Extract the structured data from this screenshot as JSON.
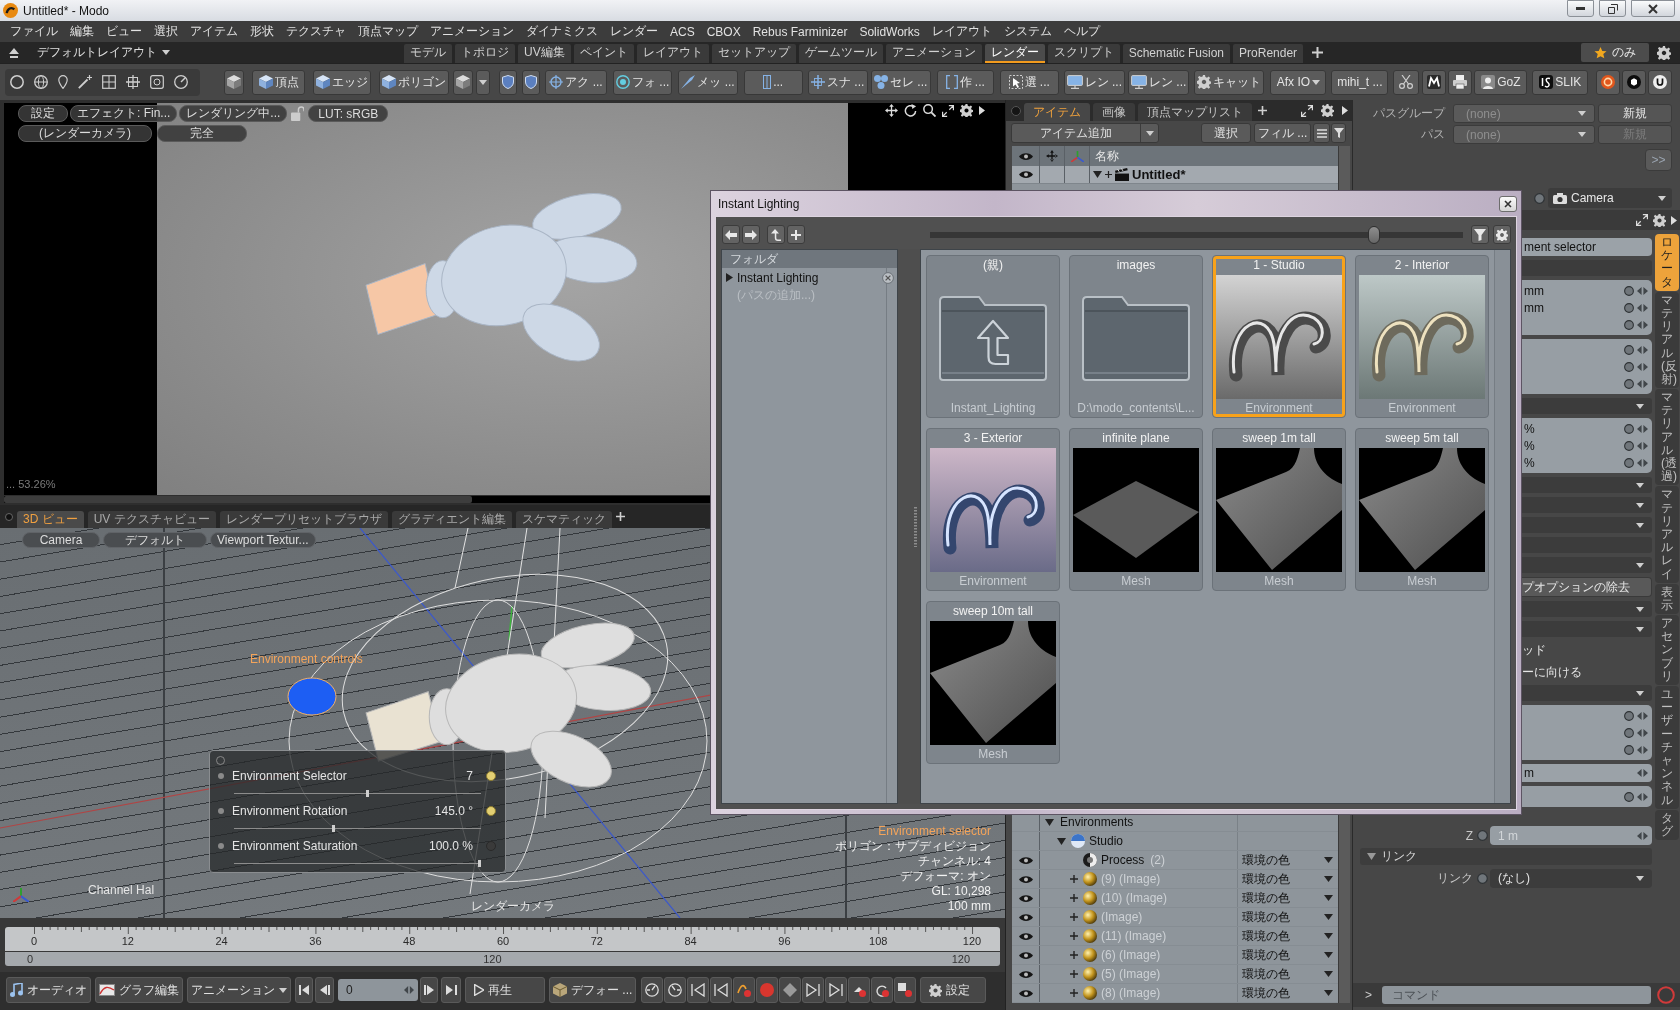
{
  "window": {
    "title": "Untitled* - Modo"
  },
  "menu_bar": [
    "ファイル",
    "編集",
    "ビュー",
    "選択",
    "アイテム",
    "形状",
    "テクスチャ",
    "頂点マップ",
    "アニメーション",
    "ダイナミクス",
    "レンダー",
    "ACS",
    "CBOX",
    "Rebus Farminizer",
    "SolidWorks",
    "レイアウト",
    "システム",
    "ヘルプ"
  ],
  "layout_bar": {
    "layout_menu": "デフォルトレイアウト",
    "tabs": [
      {
        "label": "モデル",
        "selected": false
      },
      {
        "label": "トポロジ",
        "selected": false
      },
      {
        "label": "UV編集",
        "selected": false
      },
      {
        "label": "ペイント",
        "selected": false
      },
      {
        "label": "レイアウト",
        "selected": false
      },
      {
        "label": "セットアップ",
        "selected": false
      },
      {
        "label": "ゲームツール",
        "selected": false
      },
      {
        "label": "アニメーション",
        "selected": false
      },
      {
        "label": "レンダー",
        "selected": true
      },
      {
        "label": "スクリプト",
        "selected": false
      },
      {
        "label": "Schematic Fusion",
        "selected": false
      },
      {
        "label": "ProRender",
        "selected": false
      }
    ],
    "favorites_filter": "のみ"
  },
  "toolbar": [
    "頂点",
    "エッジ",
    "ポリゴン",
    "アク ...",
    "フォ ...",
    "メッ ...",
    "...",
    "スナ ...",
    "セレ ...",
    "作 ...",
    "選 ...",
    "レン ...",
    "レン ...",
    "キャット",
    "Afx IO",
    "mihi_t ...",
    "GoZ",
    "SLIK"
  ],
  "render_view": {
    "buttons": [
      "設定",
      "エフェクト: Fin...",
      "レンダリング中...",
      "LUT: sRGB"
    ],
    "camera": "(レンダーカメラ)",
    "quality": "完全",
    "zoom": "... 53.26%"
  },
  "viewport": {
    "tabs": [
      {
        "label": "3D ビュー",
        "selected": true
      },
      {
        "label": "UV テクスチャビュー",
        "selected": false
      },
      {
        "label": "レンダープリセットブラウザ",
        "selected": false
      },
      {
        "label": "グラディエント編集",
        "selected": false
      },
      {
        "label": "スケマティック",
        "selected": false
      }
    ],
    "buttons": [
      "Camera",
      "デフォルト",
      "Viewport Textur..."
    ],
    "handle_label": "Environment controls",
    "channel_haul": [
      {
        "label": "Environment Selector",
        "value": "7",
        "level": 0.54,
        "keyed": true
      },
      {
        "label": "Environment Rotation",
        "value": "145.0 °",
        "level": 0.4,
        "keyed": true
      },
      {
        "label": "Environment Saturation",
        "value": "100.0 %",
        "level": 1,
        "keyed": false
      }
    ],
    "corner_label": "Channel Hal",
    "camera_label": "レンダーカメラ",
    "info": {
      "title": "Environment selector",
      "lines": [
        "ポリゴン：サブディビジョン",
        "チャンネル: 4",
        "デフォーマ: オン",
        "GL: 10,298",
        "100 mm"
      ]
    }
  },
  "timeline": {
    "ticks": [
      "0",
      "12",
      "24",
      "36",
      "48",
      "60",
      "72",
      "84",
      "96",
      "108",
      "120"
    ],
    "range": [
      "0",
      "120",
      "120"
    ]
  },
  "transport": {
    "audio": "オーディオ",
    "graph_editor": "グラフ編集",
    "animation_menu": "アニメーション",
    "frame": "0",
    "play": "再生",
    "deformers": "デフォー ...",
    "settings": "設定"
  },
  "item_list": {
    "tabs": [
      {
        "label": "アイテム",
        "selected": true
      },
      {
        "label": "画像",
        "selected": false
      },
      {
        "label": "頂点マップリスト",
        "selected": false
      }
    ],
    "add_item": "アイテム追加",
    "select": "選択",
    "filter": "フィル ...",
    "name_header": "名称",
    "items": [
      {
        "name": "Untitled*",
        "expanded": true,
        "visible": true
      }
    ]
  },
  "shader_tree": [
    {
      "kind": "group",
      "name": "Environments",
      "expanded": true,
      "visible": false,
      "children": [
        {
          "kind": "environment",
          "name": "Studio",
          "expanded": true,
          "visible": false,
          "children": [
            {
              "kind": "process",
              "name": "Process",
              "suffix": "(2)",
              "effect": "環境の色",
              "visible": true
            },
            {
              "kind": "image",
              "name": "(9) (Image)",
              "effect": "環境の色",
              "visible": true,
              "expanded": false
            },
            {
              "kind": "image",
              "name": "(10) (Image)",
              "effect": "環境の色",
              "visible": true,
              "expanded": false
            },
            {
              "kind": "image",
              "name": "(Image)",
              "effect": "環境の色",
              "visible": true,
              "expanded": false
            },
            {
              "kind": "image",
              "name": "(11) (Image)",
              "effect": "環境の色",
              "visible": true,
              "expanded": false
            },
            {
              "kind": "image",
              "name": "(6) (Image)",
              "effect": "環境の色",
              "visible": true,
              "expanded": false
            },
            {
              "kind": "image",
              "name": "(5) (Image)",
              "effect": "環境の色",
              "visible": true,
              "expanded": false
            },
            {
              "kind": "image",
              "name": "(8) (Image)",
              "effect": "環境の色",
              "visible": true,
              "expanded": false
            }
          ]
        }
      ]
    }
  ],
  "properties": {
    "path_rows": [
      {
        "label": "パスグループ",
        "value": "(none)",
        "button": "新規",
        "disabled": false
      },
      {
        "label": "パス",
        "value": "(none)",
        "button": "新規",
        "disabled": true
      }
    ],
    "more_button": ">>",
    "camera_menu": "Camera",
    "rows": [
      {
        "kind": "field",
        "text": "ment selector"
      },
      {
        "kind": "bar"
      },
      {
        "kind": "group",
        "channels": [
          {
            "kind": "value",
            "value": "mm"
          },
          {
            "kind": "value",
            "value": "mm"
          },
          {
            "kind": "empty"
          }
        ]
      },
      {
        "kind": "group",
        "channels": [
          {
            "kind": "empty"
          },
          {
            "kind": "empty"
          },
          {
            "kind": "empty"
          }
        ]
      },
      {
        "kind": "dropdown"
      },
      {
        "kind": "group",
        "channels": [
          {
            "kind": "value",
            "value": "%"
          },
          {
            "kind": "value",
            "value": "%"
          },
          {
            "kind": "value",
            "value": "%"
          }
        ]
      },
      {
        "kind": "dropdown"
      },
      {
        "kind": "dropdown"
      },
      {
        "kind": "dropdown"
      },
      {
        "kind": "bar"
      },
      {
        "kind": "dropdown"
      },
      {
        "kind": "button",
        "text": "プオプションの除去"
      },
      {
        "kind": "dropdown"
      },
      {
        "kind": "dropdown"
      },
      {
        "kind": "label",
        "text": "ッド"
      },
      {
        "kind": "label",
        "text": "ーに向ける"
      },
      {
        "kind": "dropdown"
      },
      {
        "kind": "group",
        "channels": [
          {
            "kind": "empty"
          },
          {
            "kind": "empty"
          },
          {
            "kind": "empty"
          }
        ]
      },
      {
        "kind": "field",
        "text": "m"
      },
      {
        "kind": "group",
        "channels": [
          {
            "kind": "empty"
          }
        ]
      }
    ],
    "transform_rows": [
      {
        "label": "Z",
        "value": "1 m",
        "disabled": true
      }
    ],
    "link_section": {
      "title": "リンク",
      "expanded": true,
      "label": "リンク",
      "value": "(なし)"
    },
    "command": {
      "prompt": ">",
      "placeholder": "コマンド"
    },
    "side_tabs": [
      {
        "label": "ロケータ",
        "selected": true
      },
      {
        "label": "マテリアル(反射)",
        "selected": false
      },
      {
        "label": "マテリアル(透過)",
        "selected": false
      },
      {
        "label": "マテリアルレイ",
        "selected": false
      },
      {
        "label": "表示",
        "selected": false
      },
      {
        "label": "アセンブリ",
        "selected": false
      },
      {
        "label": "ユーザーチャンネル",
        "selected": false
      },
      {
        "label": "タグ",
        "selected": false
      }
    ]
  },
  "instant_lighting": {
    "title": "Instant Lighting",
    "thumbnail_size": {
      "level": 0.84
    },
    "folder_header": "フォルダ",
    "folders": [
      {
        "label": "Instant Lighting",
        "expanded": false
      }
    ],
    "add_path": "(パスの追加...)",
    "tiles": [
      {
        "kind": "parent",
        "title": "(親)",
        "caption": "Instant_Lighting",
        "selected": false
      },
      {
        "kind": "folder",
        "title": "images",
        "caption": "D:\\modo_contents\\L...",
        "selected": false
      },
      {
        "kind": "environment",
        "title": "1 - Studio",
        "caption": "Environment",
        "selected": true
      },
      {
        "kind": "environment",
        "title": "2 - Interior",
        "caption": "Environment",
        "selected": false
      },
      {
        "kind": "environment",
        "title": "3 - Exterior",
        "caption": "Environment",
        "selected": false
      },
      {
        "kind": "plane",
        "title": "infinite plane",
        "caption": "Mesh",
        "selected": false
      },
      {
        "kind": "sweep",
        "title": "sweep 1m tall",
        "caption": "Mesh",
        "selected": false
      },
      {
        "kind": "sweep",
        "title": "sweep 5m tall",
        "caption": "Mesh",
        "selected": false
      },
      {
        "kind": "sweep",
        "title": "sweep 10m tall",
        "caption": "Mesh",
        "selected": false
      }
    ]
  }
}
